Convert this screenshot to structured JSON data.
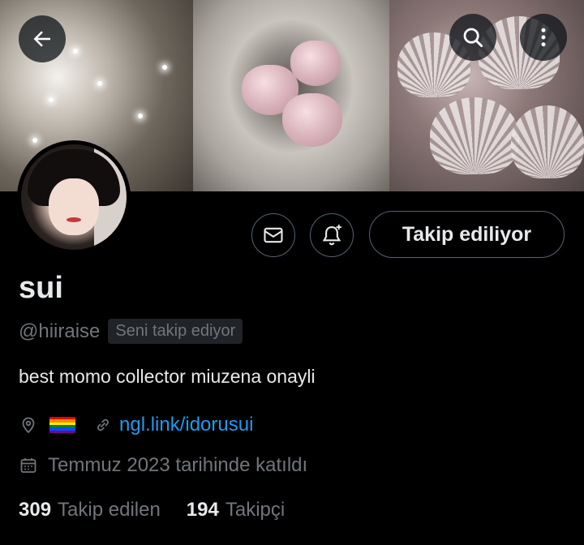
{
  "header": {
    "back_icon": "arrow-left-icon",
    "search_icon": "search-icon",
    "more_icon": "more-vertical-icon"
  },
  "profile": {
    "display_name": "sui",
    "handle": "@hiiraise",
    "follows_you_badge": "Seni takip ediyor",
    "bio": "best momo collector miuzena onayli",
    "location_icon": "location-pin-icon",
    "location_flag": "rainbow-pride-flag",
    "link_icon": "link-icon",
    "link_text": "ngl.link/idorusui",
    "calendar_icon": "calendar-icon",
    "joined_text": "Temmuz 2023 tarihinde katıldı"
  },
  "actions": {
    "message_icon": "envelope-icon",
    "notify_icon": "bell-plus-icon",
    "follow_label": "Takip ediliyor"
  },
  "stats": {
    "following_count": "309",
    "following_label": "Takip edilen",
    "followers_count": "194",
    "followers_label": "Takipçi"
  },
  "colors": {
    "background": "#000000",
    "text_primary": "#e7e9ea",
    "text_secondary": "#71767b",
    "link": "#1d9bf0",
    "border": "#536471"
  }
}
